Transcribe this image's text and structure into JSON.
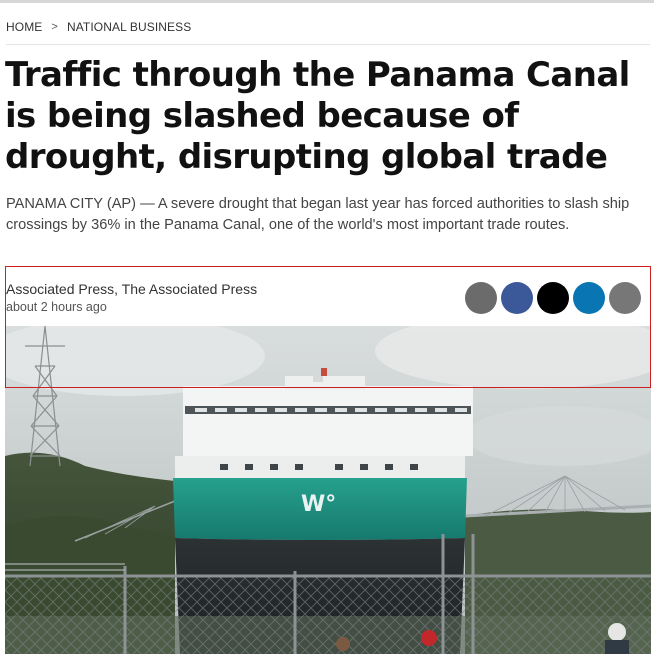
{
  "breadcrumb": {
    "home": "HOME",
    "separator": ">",
    "section": "NATIONAL BUSINESS"
  },
  "article": {
    "headline": "Traffic through the Panama Canal is being slashed because of drought, disrupting global trade",
    "summary": "PANAMA CITY (AP) — A severe drought that began last year has forced authorities to slash ship crossings by 36% in the Panama Canal, one of the world's most important trade routes.",
    "author": "Associated Press, The Associated Press",
    "timestamp": "about 2 hours ago"
  },
  "share_buttons": [
    {
      "icon": "more-share-icon",
      "color": "#6b6b6b"
    },
    {
      "icon": "facebook-icon",
      "color": "#3b5998"
    },
    {
      "icon": "x-twitter-icon",
      "color": "#000000"
    },
    {
      "icon": "linkedin-icon",
      "color": "#0a75b3"
    },
    {
      "icon": "email-icon",
      "color": "#777777"
    }
  ],
  "photo": {
    "hull_logo": "W°"
  },
  "colors": {
    "highlight_border": "#cc1f1f",
    "hull_green": "#1f8f80"
  }
}
